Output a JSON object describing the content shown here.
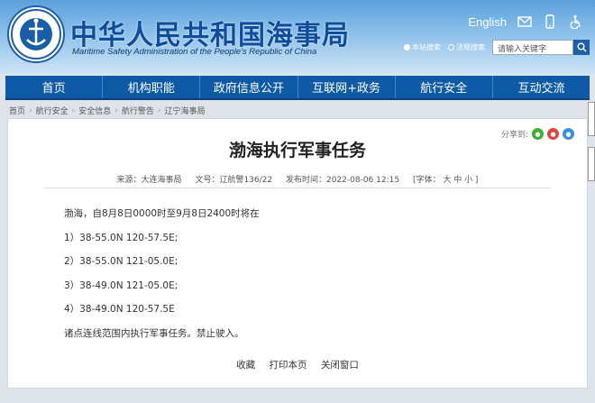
{
  "header": {
    "title": "中华人民共和国海事局",
    "subtitle": "Maritime Safety Administration of the People's Republic of China",
    "logo_text": "CHINA MSA",
    "language": "English",
    "search_scope": [
      "本站搜索",
      "法规搜索"
    ],
    "search_placeholder": "请输入关键字"
  },
  "nav": [
    "首页",
    "机构职能",
    "政府信息公开",
    "互联网+政务",
    "航行安全",
    "互动交流"
  ],
  "breadcrumb": [
    "首页",
    "航行安全",
    "安全信息",
    "航行警告",
    "辽宁海事局"
  ],
  "share_label": "分享到:",
  "article": {
    "title": "渤海执行军事任务",
    "source": "来源：大连海事局",
    "doc_no": "文号：辽航警136/22",
    "published": "发布时间：2022-08-06 12:15",
    "font_size": "[字体： 大  中  小 ]",
    "lines": [
      "渤海，自8月8日0000时至9月8日2400时将在",
      "1）38-55.0N    120-57.5E;",
      "2）38-55.0N    121-05.0E;",
      "3）38-49.0N    121-05.0E;",
      "4）38-49.0N    120-57.5E",
      "诸点连线范围内执行军事任务。禁止驶入。"
    ]
  },
  "footer_links": [
    "收藏",
    "打印本页",
    "关闭窗口"
  ],
  "colors": {
    "nav": "#0f5aa6",
    "title": "#0e4d9c"
  }
}
